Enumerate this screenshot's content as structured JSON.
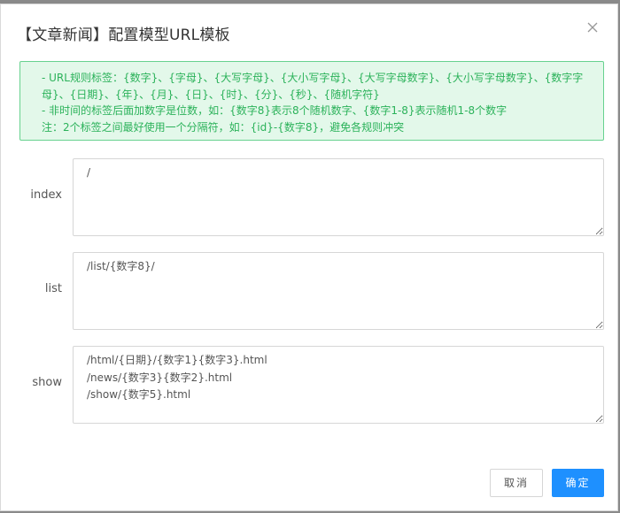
{
  "dialog": {
    "title": "【文章新闻】配置模型URL模板",
    "close_icon": "close-icon"
  },
  "notice": {
    "lines": [
      "- URL规则标签：{数字}、{字母}、{大写字母}、{大小写字母}、{大写字母数字}、{大小写字母数字}、{数字字母}、{日期}、{年}、{月}、{日}、{时}、{分}、{秒}、{随机字符}",
      "- 非时间的标签后面加数字是位数，如：{数字8}表示8个随机数字、{数字1-8}表示随机1-8个数字",
      "注：2个标签之间最好使用一个分隔符，如：{id}-{数字8}，避免各规则冲突"
    ],
    "color": "#2bb25a",
    "background": "#e3f8ea"
  },
  "fields": [
    {
      "label": "index",
      "value": "/"
    },
    {
      "label": "list",
      "value": "/list/{数字8}/"
    },
    {
      "label": "show",
      "value": "/html/{日期}/{数字1}{数字3}.html\n/news/{数字3}{数字2}.html\n/show/{数字5}.html"
    }
  ],
  "buttons": {
    "cancel_label": "取消",
    "ok_label": "确定",
    "ok_color": "#1e90ff"
  }
}
